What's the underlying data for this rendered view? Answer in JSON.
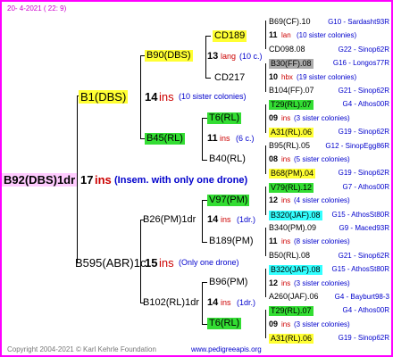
{
  "header": {
    "date": "20-  4-2021 ( 22:  9)"
  },
  "root": {
    "id": "B92(DBS)1dr",
    "count": "17",
    "ins": "ins",
    "note": "(Insem. with only one drone)"
  },
  "gen1": [
    {
      "id": "B1(DBS)",
      "count": "14",
      "ins": "ins",
      "note": "(10 sister colonies)"
    },
    {
      "id": "B595(ABR)1c",
      "count": "15",
      "ins": "ins",
      "note": "(Only one drone)"
    }
  ],
  "gen2": [
    {
      "id": "B90(DBS)",
      "count": "13",
      "ins": "lang",
      "note": "(10 c.)"
    },
    {
      "id": "B45(RL)",
      "count": "11",
      "ins": "ins",
      "note": "(6 c.)"
    },
    {
      "id": "B26(PM)1dr",
      "count": "14",
      "ins": "ins",
      "note": "(1dr.)"
    },
    {
      "id": "B102(RL)1dr",
      "count": "14",
      "ins": "ins",
      "note": "(1dr.)"
    }
  ],
  "gen3": [
    {
      "id": "CD189"
    },
    {
      "id": "CD217"
    },
    {
      "id": "T6(RL)"
    },
    {
      "id": "B40(RL)"
    },
    {
      "id": "V97(PM)"
    },
    {
      "id": "B189(PM)"
    },
    {
      "id": "B96(PM)"
    },
    {
      "id": "T6(RL)"
    }
  ],
  "gen4": [
    {
      "a": "B69(CF).10",
      "b": "G10 - Sardasht93R"
    },
    {
      "a": "11",
      "ins": "lan",
      "note": "(10 sister colonies)"
    },
    {
      "a": "CD098.08",
      "b": "G22 - Sinop62R"
    },
    {
      "a": "B30(FF).08",
      "b": "G16 - Longos77R"
    },
    {
      "a": "10",
      "ins": "hbx",
      "note": "(19 sister colonies)"
    },
    {
      "a": "B104(FF).07",
      "b": "G21 - Sinop62R"
    },
    {
      "a": "T29(RL).07",
      "b": "G4 - Athos00R"
    },
    {
      "a": "09",
      "ins": "ins",
      "note": "(3 sister colonies)"
    },
    {
      "a": "A31(RL).06",
      "b": "G19 - Sinop62R"
    },
    {
      "a": "B95(RL).05",
      "b": "G12 - SinopEgg86R"
    },
    {
      "a": "08",
      "ins": "ins",
      "note": "(5 sister colonies)"
    },
    {
      "a": "B68(PM).04",
      "b": "G19 - Sinop62R"
    },
    {
      "a": "V79(RL).12",
      "b": "G7 - Athos00R"
    },
    {
      "a": "12",
      "ins": "ins",
      "note": "(4 sister colonies)"
    },
    {
      "a": "B320(JAF).08",
      "b": "G15 - AthosSt80R"
    },
    {
      "a": "B340(PM).09",
      "b": "G9 - Maced93R"
    },
    {
      "a": "11",
      "ins": "ins",
      "note": "(8 sister colonies)"
    },
    {
      "a": "B50(RL).08",
      "b": "G21 - Sinop62R"
    },
    {
      "a": "B320(JAF).08",
      "b": "G15 - AthosSt80R"
    },
    {
      "a": "12",
      "ins": "ins",
      "note": "(3 sister colonies)"
    },
    {
      "a": "A260(JAF).06",
      "b": "G4 - Bayburt98-3"
    },
    {
      "a": "T29(RL).07",
      "b": "G4 - Athos00R"
    },
    {
      "a": "09",
      "ins": "ins",
      "note": "(3 sister colonies)"
    },
    {
      "a": "A31(RL).06",
      "b": "G19 - Sinop62R"
    }
  ],
  "footer": {
    "copyright": "Copyright 2004-2021 © Karl Kehrle Foundation",
    "site": "www.pedigreeapis.org"
  },
  "colors": {
    "frame": "#ff00ff",
    "yellow": "#ffff33",
    "green": "#33dd33",
    "gray": "#aaaaaa",
    "cyan": "#33ffff",
    "pink": "#ffccff"
  }
}
